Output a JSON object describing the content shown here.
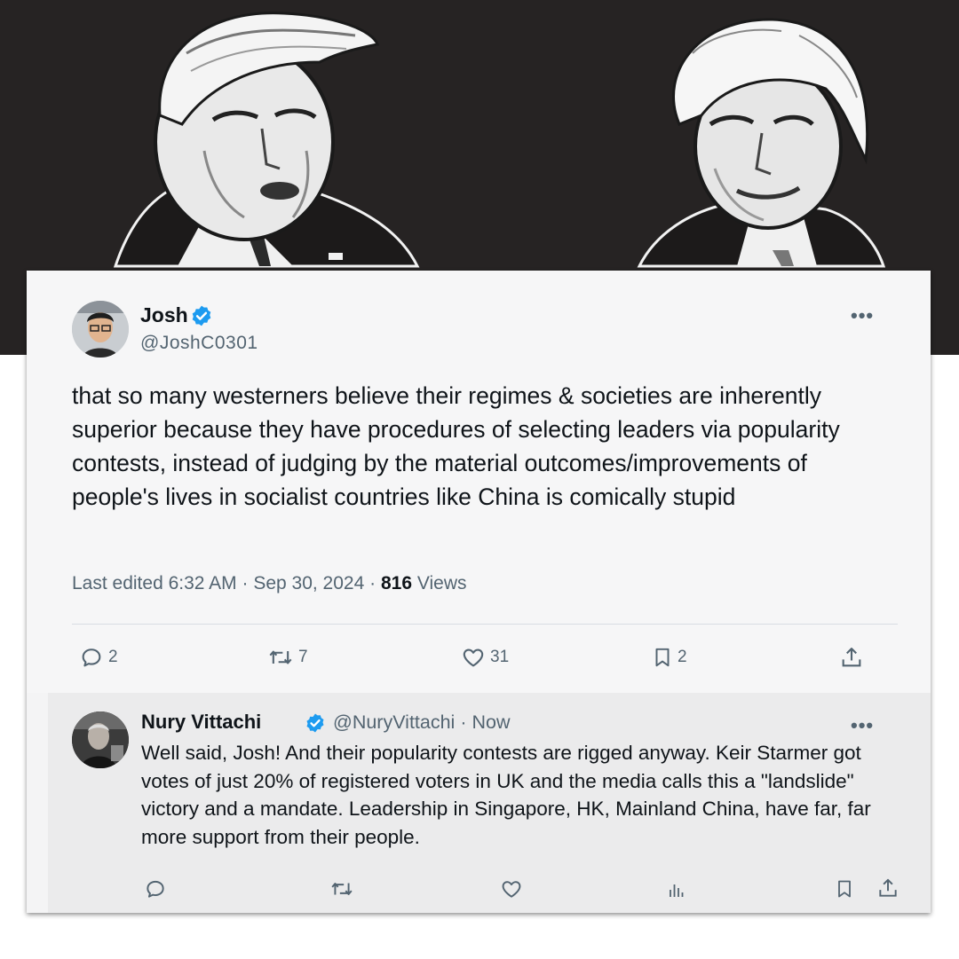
{
  "hero": {
    "left_portrait": "caricature-portrait",
    "right_portrait": "caricature-portrait"
  },
  "tweet": {
    "name": "Josh",
    "handle": "@JoshC0301",
    "more_icon": "more-icon",
    "text": "that so many westerners believe their regimes & societies are inherently superior because they have procedures of selecting leaders via popularity contests, instead of judging by the material outcomes/improvements of people's lives in socialist countries like China is comically stupid",
    "edited_label": "Last edited 6:32 AM",
    "separator": "·",
    "date": "Sep 30, 2024",
    "views_count": "816",
    "views_label": "Views",
    "actions": {
      "replies": "2",
      "reposts": "7",
      "likes": "31",
      "bookmarks": "2"
    }
  },
  "reply": {
    "name": "Nury Vittachi",
    "handle": "@NuryVittachi",
    "separator": "·",
    "time": "Now",
    "text": "Well said, Josh! And their popularity contests are rigged anyway. Keir Starmer got votes of just 20% of registered voters in UK and the media calls this a \"landslide\" victory and a mandate. Leadership in Singapore, HK, Mainland China, have far, far more support from their people."
  },
  "colors": {
    "verified": "#1d9bf0",
    "secondary_text": "#536471",
    "primary_text": "#0f1419",
    "hero_background": "#262323"
  }
}
